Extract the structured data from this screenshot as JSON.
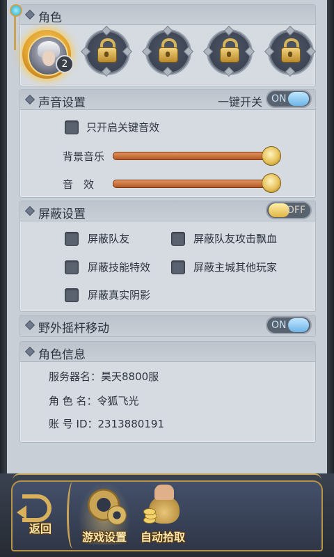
{
  "role": {
    "title": "角色",
    "level": "2"
  },
  "sound": {
    "title": "声音设置",
    "one_key_label": "一键开关",
    "one_key_state": "ON",
    "key_sfx_only": "只开启关键音效",
    "bgm_label": "背景音乐",
    "bgm_level": 1.0,
    "sfx_label": "音　效",
    "sfx_level": 1.0
  },
  "shield": {
    "title": "屏蔽设置",
    "state": "OFF",
    "options": [
      "屏蔽队友",
      "屏蔽队友攻击飘血",
      "屏蔽技能特效",
      "屏蔽主城其他玩家",
      "屏蔽真实阴影"
    ]
  },
  "joystick": {
    "title": "野外摇杆移动",
    "state": "ON"
  },
  "info": {
    "title": "角色信息",
    "server": "服务器名：昊天8800服",
    "role_name": "角 色 名：令狐飞光",
    "account": "账 号 ID：2313880191"
  },
  "bottom_nav": {
    "back": "返回",
    "game_settings": "游戏设置",
    "auto_pickup": "自动拾取"
  },
  "colors": {
    "accent_gold": "#c9a454",
    "toggle_on": "#6fb5e7",
    "slider": "#c96a34"
  }
}
